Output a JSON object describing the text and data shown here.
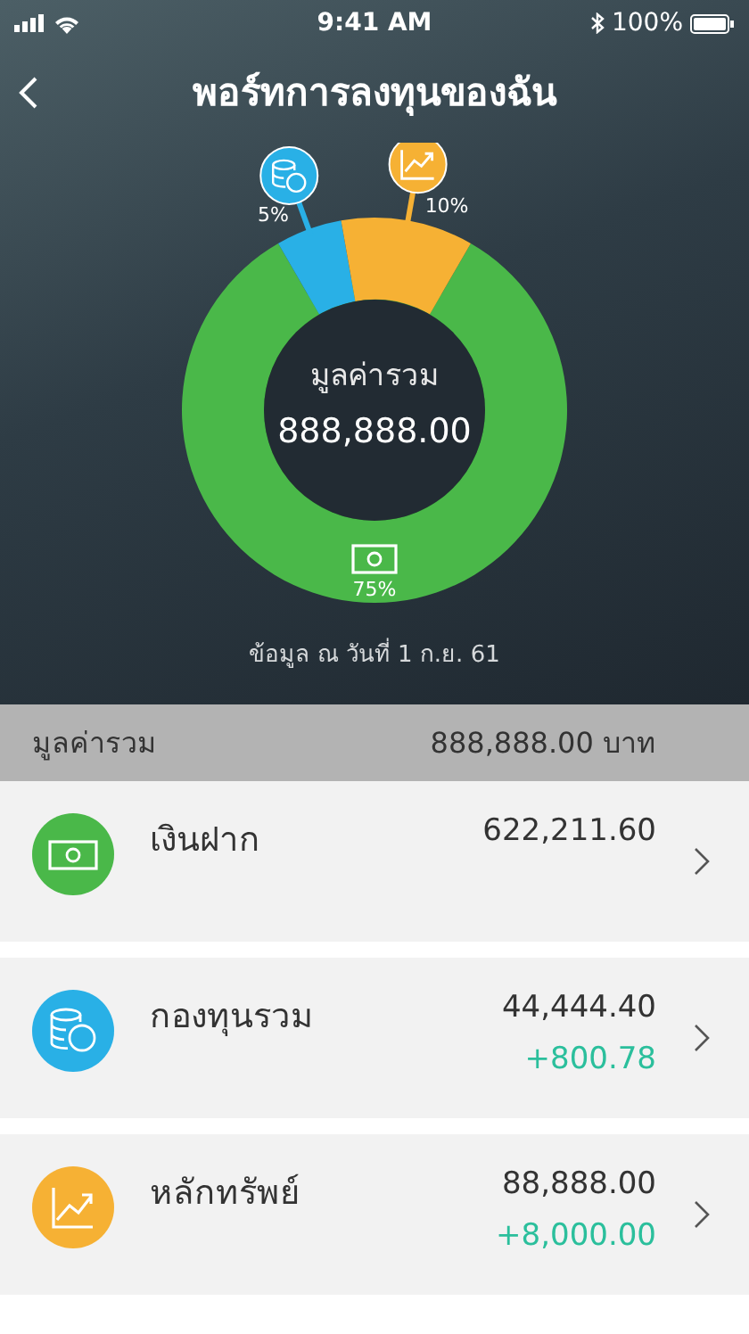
{
  "status_bar": {
    "time": "9:41 AM",
    "battery": "100%"
  },
  "header": {
    "title": "พอร์ทการลงทุนของฉัน"
  },
  "portfolio_chart": {
    "center_label": "มูลค่ารวม",
    "center_value": "888,888.00",
    "slices": [
      {
        "kind": "cash",
        "color": "#4ab849"
      },
      {
        "kind": "fund",
        "color": "#29b0e6"
      },
      {
        "kind": "stock",
        "color": "#f6b134"
      }
    ],
    "chart_data": {
      "type": "donut",
      "values": [
        75,
        5,
        10
      ],
      "value_labels": [
        "75%",
        "5%",
        "10%"
      ]
    },
    "note": "ข้อมูล ณ วันที่ 1 ก.ย. 61"
  },
  "summary": {
    "label": "มูลค่ารวม",
    "value": "888,888.00 บาท"
  },
  "accounts": [
    {
      "kind": "cash",
      "color": "#4ab849",
      "name": "เงินฝาก",
      "value": "622,211.60"
    },
    {
      "kind": "fund",
      "color": "#29b0e6",
      "name": "กองทุนรวม",
      "value": "44,444.40",
      "change": "+800.78"
    },
    {
      "kind": "stock",
      "color": "#f6b134",
      "name": "หลักทรัพย์",
      "value": "88,888.00",
      "change": "+8,000.00"
    }
  ]
}
